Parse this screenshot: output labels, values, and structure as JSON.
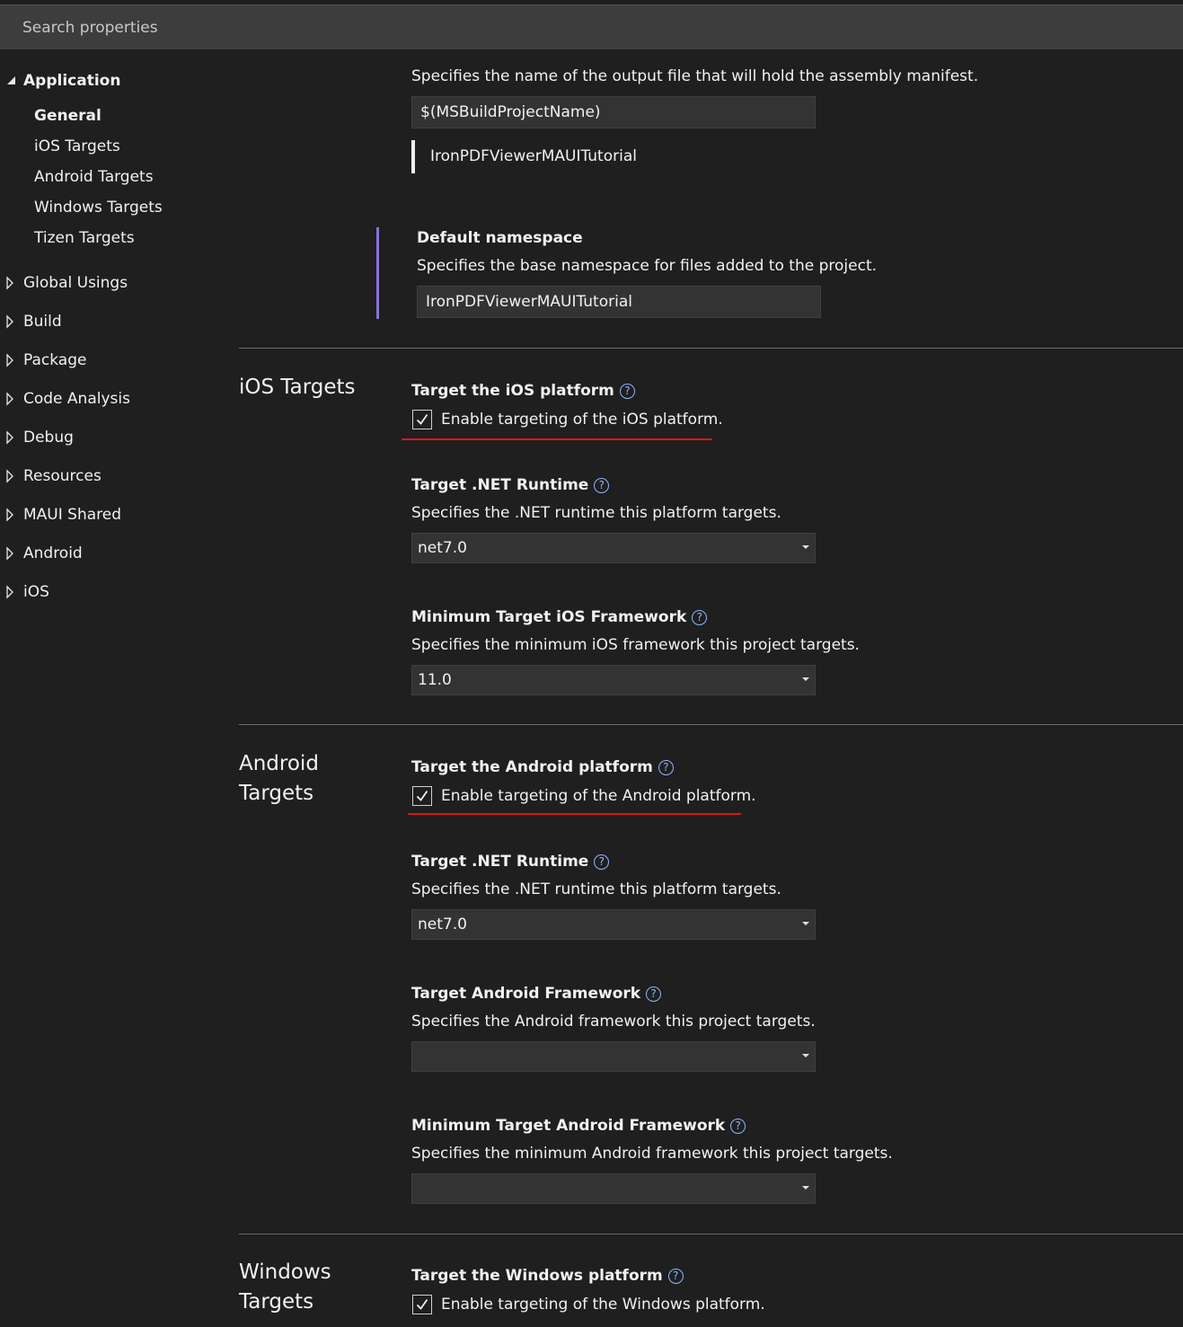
{
  "search": {
    "placeholder": "Search properties"
  },
  "sidebar": {
    "groups": [
      {
        "label": "Application",
        "expanded": true
      },
      {
        "label": "Global Usings"
      },
      {
        "label": "Build"
      },
      {
        "label": "Package"
      },
      {
        "label": "Code Analysis"
      },
      {
        "label": "Debug"
      },
      {
        "label": "Resources"
      },
      {
        "label": "MAUI Shared"
      },
      {
        "label": "Android"
      },
      {
        "label": "iOS"
      }
    ],
    "application_items": [
      {
        "label": "General",
        "selected": true
      },
      {
        "label": "iOS Targets"
      },
      {
        "label": "Android Targets"
      },
      {
        "label": "Windows Targets"
      },
      {
        "label": "Tizen Targets"
      }
    ]
  },
  "general": {
    "assembly": {
      "description": "Specifies the name of the output file that will hold the assembly manifest.",
      "value": "$(MSBuildProjectName)",
      "evaluated": "IronPDFViewerMAUITutorial"
    },
    "default_namespace": {
      "title": "Default namespace",
      "description": "Specifies the base namespace for files added to the project.",
      "value": "IronPDFViewerMAUITutorial"
    }
  },
  "ios_targets": {
    "section_title": "iOS Targets",
    "target_platform": {
      "title": "Target the iOS platform",
      "checkbox_label": "Enable targeting of the iOS platform.",
      "checked": true
    },
    "net_runtime": {
      "title": "Target .NET Runtime",
      "description": "Specifies the .NET runtime this platform targets.",
      "value": "net7.0"
    },
    "min_framework": {
      "title": "Minimum Target iOS Framework",
      "description": "Specifies the minimum iOS framework this project targets.",
      "value": "11.0"
    }
  },
  "android_targets": {
    "section_title": "Android Targets",
    "target_platform": {
      "title": "Target the Android platform",
      "checkbox_label": "Enable targeting of the Android platform.",
      "checked": true
    },
    "net_runtime": {
      "title": "Target .NET Runtime",
      "description": "Specifies the .NET runtime this platform targets.",
      "value": "net7.0"
    },
    "framework": {
      "title": "Target Android Framework",
      "description": "Specifies the Android framework this project targets.",
      "value": ""
    },
    "min_framework": {
      "title": "Minimum Target Android Framework",
      "description": "Specifies the minimum Android framework this project targets.",
      "value": ""
    }
  },
  "windows_targets": {
    "section_title": "Windows Targets",
    "target_platform": {
      "title": "Target the Windows platform",
      "checkbox_label": "Enable targeting of the Windows platform.",
      "checked": true
    }
  },
  "icons": {
    "help": "question-circle-icon",
    "expanded": "triangle-down-icon",
    "collapsed": "triangle-right-icon",
    "check": "checkmark-icon",
    "dropdown": "chevron-down-icon"
  },
  "colors": {
    "background": "#1f1f1f",
    "help_icon": "#8fb4ff",
    "accent": "#8a72d8",
    "annotation": "#e0141e"
  }
}
